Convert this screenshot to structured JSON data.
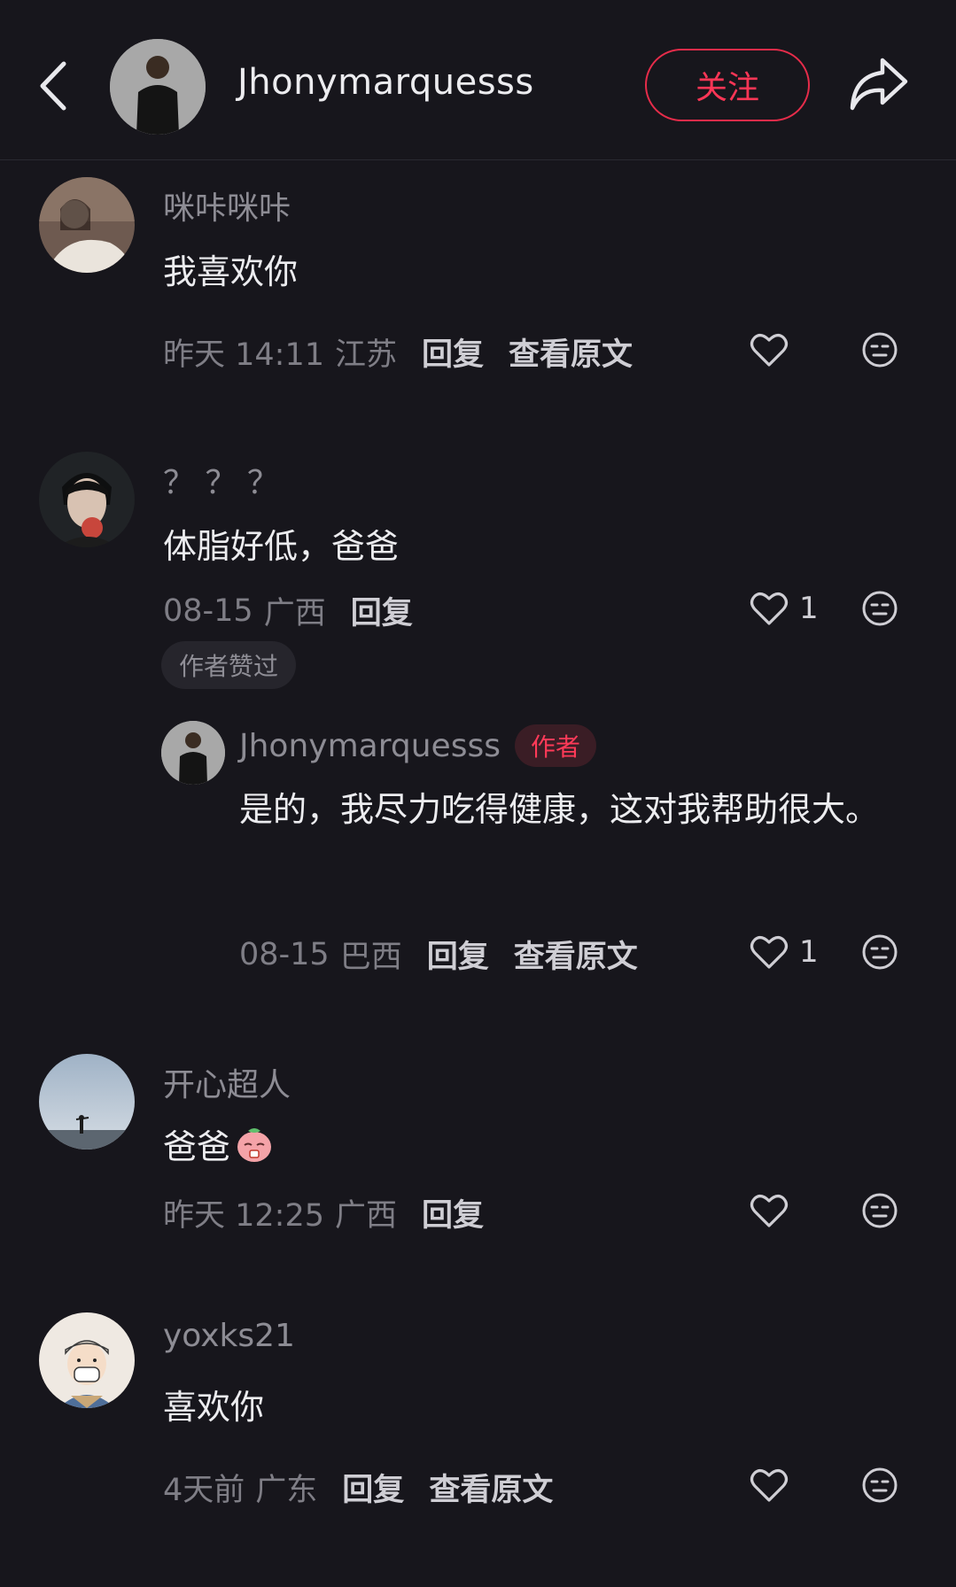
{
  "header": {
    "username": "Jhonymarquesss",
    "follow_label": "关注",
    "back_icon": "chevron-left-icon",
    "share_icon": "share-arrow-icon"
  },
  "comments": [
    {
      "username": "咪咔咪咔",
      "text": "我喜欢你",
      "time": "昨天 14:11",
      "location": "江苏",
      "reply_label": "回复",
      "view_original_label": "查看原文",
      "likes": ""
    },
    {
      "username": "？ ？ ？",
      "text": "体脂好低，爸爸",
      "time": "08-15",
      "location": "广西",
      "reply_label": "回复",
      "likes": "1",
      "badge": "作者赞过",
      "reply": {
        "username": "Jhonymarquesss",
        "author_tag": "作者",
        "text": "是的，我尽力吃得健康，这对我帮助很大。",
        "time": "08-15",
        "location": "巴西",
        "reply_label": "回复",
        "view_original_label": "查看原文",
        "likes": "1"
      }
    },
    {
      "username": "开心超人",
      "text": "爸爸",
      "time": "昨天 12:25",
      "location": "广西",
      "reply_label": "回复",
      "likes": ""
    },
    {
      "username": "yoxks21",
      "text": "喜欢你",
      "time": "4天前",
      "location": "广东",
      "reply_label": "回复",
      "view_original_label": "查看原文",
      "likes": ""
    }
  ],
  "colors": {
    "background": "#17161c",
    "accent": "#ff3656",
    "muted_text": "#8d8c94"
  }
}
